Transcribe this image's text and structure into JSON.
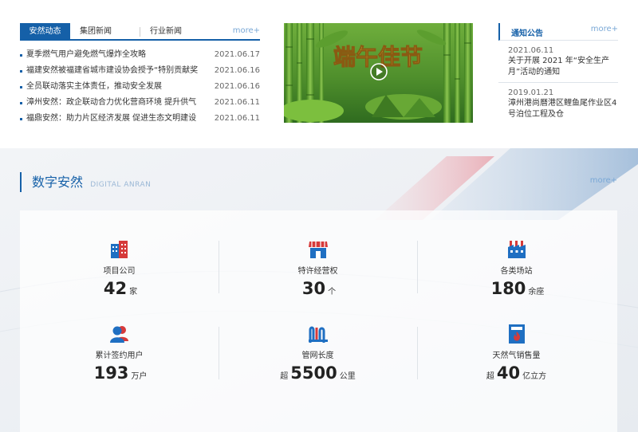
{
  "news": {
    "tabs": [
      "安然动态",
      "集团新闻",
      "行业新闻"
    ],
    "more": "more+",
    "items": [
      {
        "title": "夏季燃气用户避免燃气爆炸全攻略",
        "date": "2021.06.17"
      },
      {
        "title": "福建安然被福建省城市建设协会授予“特别贡献奖",
        "date": "2021.06.16"
      },
      {
        "title": "全员联动落实主体责任，推动安全发展",
        "date": "2021.06.16"
      },
      {
        "title": "漳州安然：政企联动合力优化营商环境 提升供气",
        "date": "2021.06.11"
      },
      {
        "title": "福鼎安然：助力片区经济发展 促进生态文明建设",
        "date": "2021.06.11"
      }
    ]
  },
  "video": {
    "caption": "端午佳节",
    "icon": "play-icon"
  },
  "notice": {
    "title": "通知公告",
    "more": "more+",
    "items": [
      {
        "date": "2021.06.11",
        "lines": [
          "关于开展 2021 年“安全生产",
          "月”活动的通知"
        ]
      },
      {
        "date": "2019.01.21",
        "lines": [
          "漳州港尚曆港区鲤鱼尾作业区4",
          "号泊位工程及仓"
        ]
      }
    ]
  },
  "digital": {
    "title": "数字安然",
    "subtitle": "DIGITAL ANRAN",
    "more": "more+",
    "stats": [
      {
        "icon": "building-icon",
        "label": "项目公司",
        "prefix": "",
        "value": "42",
        "unit": "家"
      },
      {
        "icon": "store-icon",
        "label": "特许经营权",
        "prefix": "",
        "value": "30",
        "unit": "个"
      },
      {
        "icon": "factory-icon",
        "label": "各类场站",
        "prefix": "",
        "value": "180",
        "unit": "余座"
      },
      {
        "icon": "users-icon",
        "label": "累计签约用户",
        "prefix": "",
        "value": "193",
        "unit": "万户"
      },
      {
        "icon": "pipeline-icon",
        "label": "管网长度",
        "prefix": "超",
        "value": "5500",
        "unit": "公里"
      },
      {
        "icon": "gas-flame-icon",
        "label": "天然气销售量",
        "prefix": "超",
        "value": "40",
        "unit": "亿立方"
      }
    ]
  },
  "colors": {
    "primary": "#1560a8",
    "accent": "#d63a3a",
    "more": "#7aa8d6"
  }
}
